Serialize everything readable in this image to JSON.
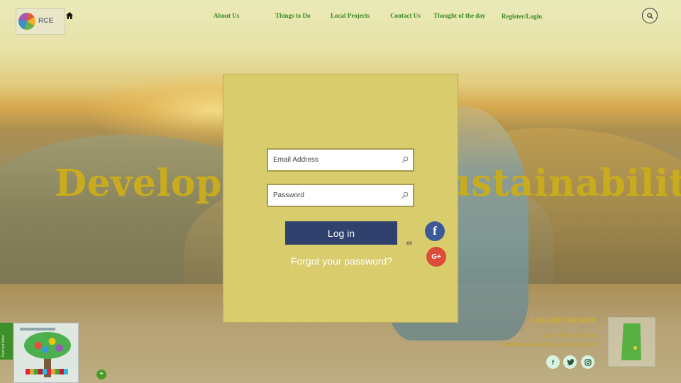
{
  "header": {
    "logo_text": "RCE",
    "nav": [
      {
        "label": "About Us"
      },
      {
        "label": "Things to Do"
      },
      {
        "label": "Local Projects"
      },
      {
        "label": "Contact Us"
      },
      {
        "label": "Thought of the day"
      },
      {
        "label": "Register/Login"
      }
    ]
  },
  "hero": {
    "title": "Development for Sustainability"
  },
  "login": {
    "email_placeholder": "Email Address",
    "password_placeholder": "Password",
    "login_label": "Log in",
    "or_label": "or",
    "forgot_label": "Forgot your password?",
    "facebook_glyph": "f",
    "google_glyph": "G+"
  },
  "sidebar": {
    "find_more_label": "Find out More",
    "plus_label": "+"
  },
  "location": {
    "title": "SASKATCHEWAN",
    "line1": "Land of Thousand Lakes",
    "line2": "Saskatchewan's Grasslands National Park"
  },
  "social_footer": {
    "facebook": "f",
    "twitter": "t",
    "instagram": "ig"
  },
  "colors": {
    "nav_green": "#3f8a28",
    "hero_gold": "#c9ac1e",
    "modal_bg": "#d8cc6c",
    "login_button": "#2f416c",
    "facebook_blue": "#3b5998",
    "google_red": "#dd4b39"
  }
}
